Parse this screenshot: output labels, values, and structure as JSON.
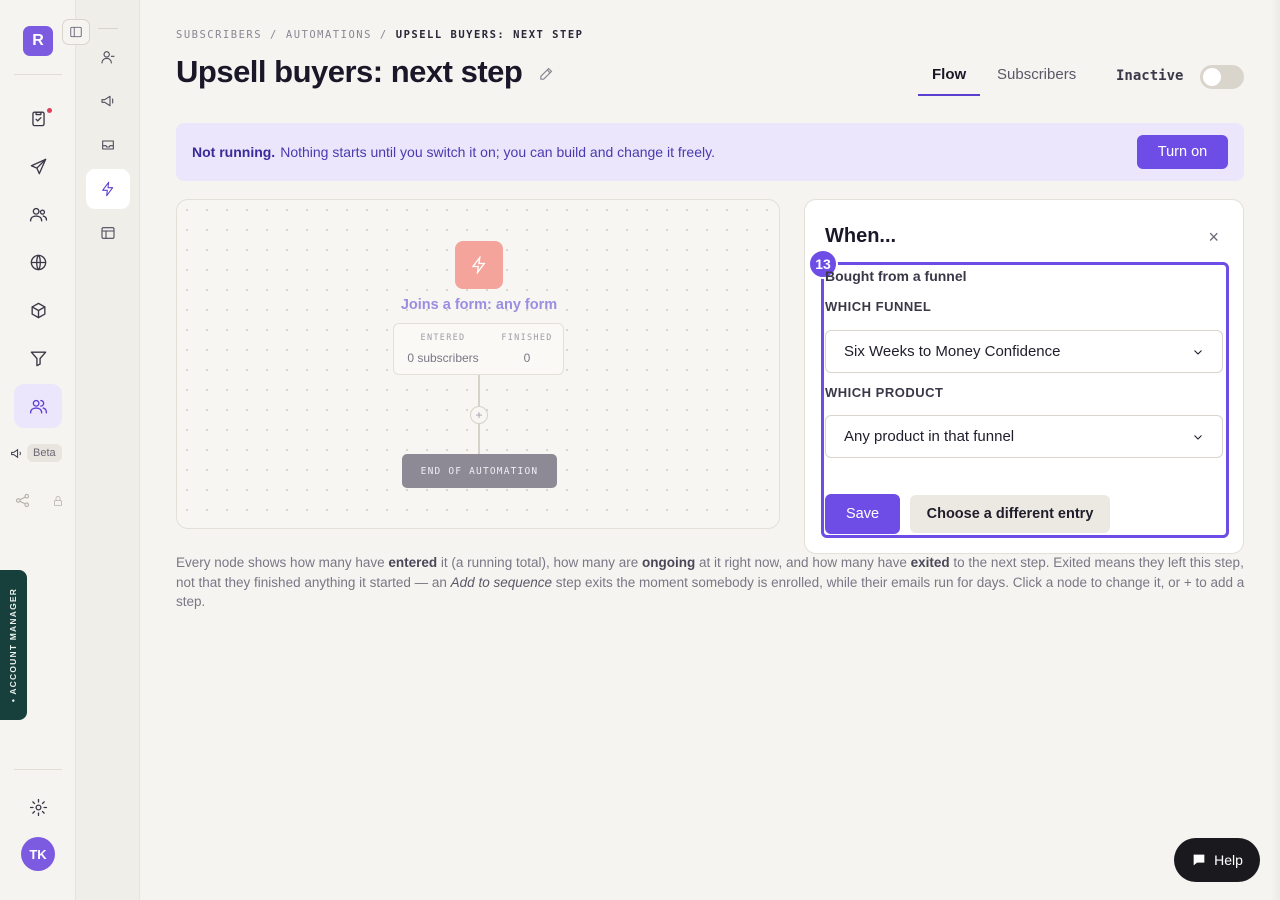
{
  "rail": {
    "logo_letter": "R",
    "beta_label": "Beta",
    "account_manager_label": "• ACCOUNT MANAGER",
    "avatar_initials": "TK",
    "items": [
      {
        "icon": "clipboard-check-icon"
      },
      {
        "icon": "send-icon"
      },
      {
        "icon": "users-icon"
      },
      {
        "icon": "globe-icon"
      },
      {
        "icon": "package-icon"
      },
      {
        "icon": "funnel-icon"
      },
      {
        "icon": "people-icon",
        "active": true
      },
      {
        "icon": "megaphone-icon"
      },
      {
        "icon": "share-icon"
      },
      {
        "icon": "gear-icon"
      }
    ]
  },
  "subrail": {
    "items": [
      {
        "icon": "person-icon"
      },
      {
        "icon": "broadcast-icon"
      },
      {
        "icon": "inbox-icon"
      },
      {
        "icon": "lightning-icon",
        "active": true
      },
      {
        "icon": "layout-icon"
      }
    ]
  },
  "breadcrumb": {
    "items": [
      "SUBSCRIBERS",
      "/",
      "AUTOMATIONS",
      "/",
      "UPSELL BUYERS: NEXT STEP"
    ]
  },
  "header": {
    "title": "Upsell buyers: next step",
    "tabs": [
      {
        "label": "Flow",
        "active": true
      },
      {
        "label": "Subscribers",
        "active": false
      }
    ],
    "status_label": "Inactive",
    "toggle_on": false
  },
  "banner": {
    "bold": "Not running.",
    "text": "Nothing starts until you switch it on; you can build and change it freely.",
    "button_label": "Turn on"
  },
  "canvas": {
    "trigger_label": "Joins a form: any form",
    "entered_label": "ENTERED",
    "entered_value": "0 subscribers",
    "finished_label": "FINISHED",
    "finished_value": "0",
    "add_step_label": "+",
    "end_label": "END OF AUTOMATION"
  },
  "panel": {
    "title": "When...",
    "close_label": "×",
    "step_number": "13",
    "trigger_name": "Bought from a funnel",
    "funnel_label": "WHICH FUNNEL",
    "funnel_value": "Six Weeks to Money Confidence",
    "product_label": "WHICH PRODUCT",
    "product_value": "Any product in that funnel",
    "save_label": "Save",
    "choose_label": "Choose a different entry"
  },
  "help": {
    "p1": "Every node shows how many have ",
    "b1": "entered",
    "p2": " it (a running total), how many are ",
    "b2": "ongoing",
    "p3": " at it right now, and how many have ",
    "b3": "exited",
    "p4": " to the next step. Exited means they left this step, not that they finished anything it started — an ",
    "i1": "Add to sequence",
    "p5": " step exits the moment somebody is enrolled, while their emails run for days. Click a node to change it, or + to add a step."
  },
  "help_button": {
    "label": "Help"
  },
  "colors": {
    "accent": "#6e4de6",
    "trigger": "#f4a49a",
    "banner_bg": "#ebe6fb"
  }
}
